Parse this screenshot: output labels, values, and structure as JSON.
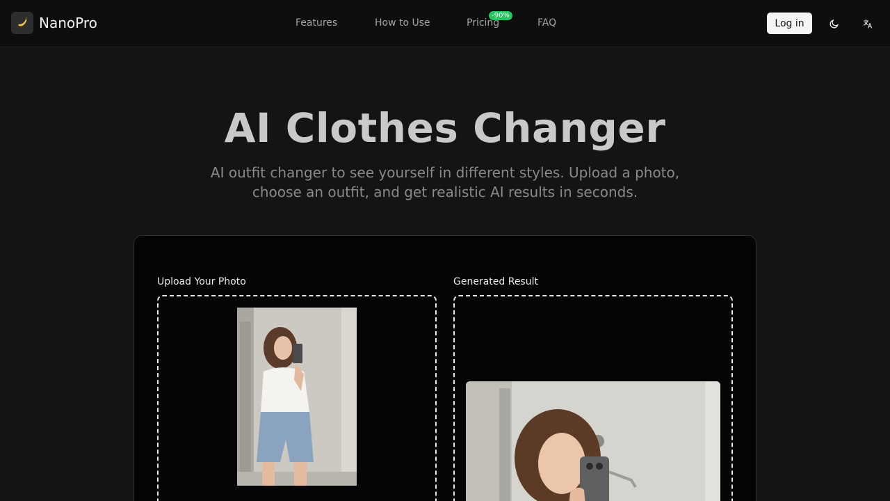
{
  "header": {
    "brand": "NanoPro",
    "logo_icon": "banana-icon",
    "nav": [
      {
        "label": "Features"
      },
      {
        "label": "How to Use"
      },
      {
        "label": "Pricing"
      },
      {
        "label": "FAQ"
      }
    ],
    "pricing_badge": "-90%",
    "login_label": "Log in",
    "theme_icon": "moon-icon",
    "language_icon": "translate-icon"
  },
  "hero": {
    "title": "AI Clothes Changer",
    "subtitle": "AI outfit changer to see yourself in different styles. Upload a photo, choose an outfit, and get realistic AI results in seconds."
  },
  "tool": {
    "upload_label": "Upload Your Photo",
    "result_label": "Generated Result"
  },
  "colors": {
    "background": "#141414",
    "accent_badge": "#22c55e",
    "login_button": "#f5f5f5"
  }
}
